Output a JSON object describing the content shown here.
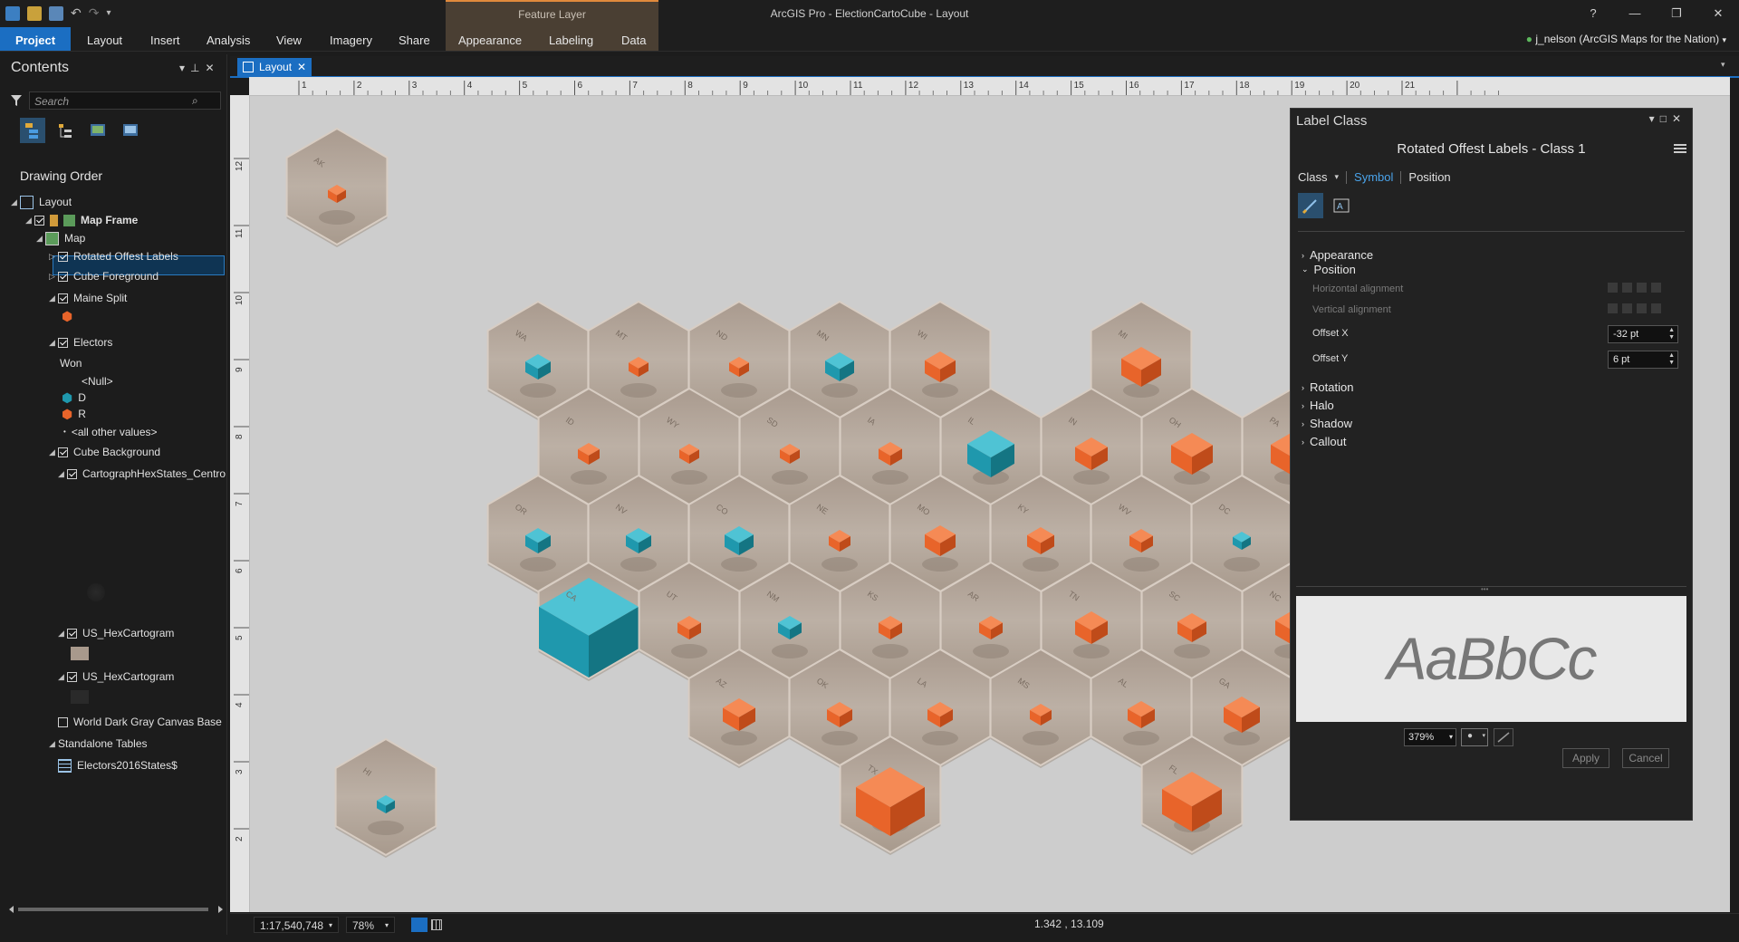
{
  "app": {
    "title": "ArcGIS Pro - ElectionCartoCube - Layout",
    "context_tab_group": "Feature Layer",
    "window_buttons": [
      "?",
      "—",
      "❐",
      "✕"
    ],
    "user": "j_nelson (ArcGIS Maps for the Nation)"
  },
  "ribbon": {
    "tabs": [
      "Project",
      "Layout",
      "Insert",
      "Analysis",
      "View",
      "Imagery",
      "Share",
      "Appearance",
      "Labeling",
      "Data"
    ]
  },
  "contents": {
    "title": "Contents",
    "search_placeholder": "Search",
    "drawing_order_label": "Drawing Order",
    "tree": {
      "layout": "Layout",
      "map_frame": "Map Frame",
      "map": "Map",
      "rotated_offset_labels": "Rotated Offest Labels",
      "cube_foreground": "Cube Foreground",
      "maine_split": "Maine Split",
      "electors": "Electors",
      "won_field": "Won",
      "null_value": "<Null>",
      "d_value": "D",
      "r_value": "R",
      "all_other": "<all other values>",
      "cube_background": "Cube Background",
      "cartograph_centroids": "CartographHexStates_Centro",
      "hex_cartogram_1": "US_HexCartogram",
      "hex_cartogram_2": "US_HexCartogram",
      "basemap": "World Dark Gray Canvas Base",
      "standalone_tables": "Standalone Tables",
      "electors_table": "Electors2016States$"
    }
  },
  "layout_view": {
    "tab_label": "Layout",
    "ruler_top": [
      "1",
      "2",
      "3",
      "4",
      "5",
      "6",
      "7",
      "8",
      "9",
      "10",
      "11",
      "12",
      "13",
      "14",
      "15",
      "16",
      "17",
      "18",
      "19",
      "20",
      "21"
    ],
    "ruler_left": [
      "12",
      "11",
      "10",
      "9",
      "8",
      "7",
      "6",
      "5",
      "4",
      "3",
      "2"
    ],
    "hex_labels": [
      "AK",
      "HI",
      "WA",
      "MT",
      "ND",
      "MN",
      "WI",
      "MI",
      "ID",
      "WY",
      "SD",
      "IA",
      "IL",
      "IN",
      "OH",
      "PA",
      "OR",
      "NV",
      "CO",
      "NE",
      "MO",
      "KY",
      "WV",
      "DC",
      "CA",
      "UT",
      "NM",
      "KS",
      "AR",
      "TN",
      "SC",
      "NC",
      "AZ",
      "OK",
      "LA",
      "MS",
      "AL",
      "GA",
      "TX",
      "FL"
    ]
  },
  "statusbar": {
    "scale": "1:17,540,748",
    "zoom": "78%",
    "coords": "1.342 , 13.109"
  },
  "label_pane": {
    "title": "Label Class",
    "class_name": "Rotated Offest Labels - Class 1",
    "subtabs": {
      "class": "Class",
      "symbol": "Symbol",
      "position": "Position"
    },
    "sections": {
      "appearance": "Appearance",
      "position": "Position",
      "rotation": "Rotation",
      "halo": "Halo",
      "shadow": "Shadow",
      "callout": "Callout"
    },
    "props": {
      "horizontal_alignment": "Horizontal alignment",
      "vertical_alignment": "Vertical alignment",
      "offset_x_label": "Offset X",
      "offset_x_value": "-32 pt",
      "offset_y_label": "Offset Y",
      "offset_y_value": "6 pt"
    },
    "preview_text": "AaBbCc",
    "preview_zoom": "379%",
    "apply": "Apply",
    "cancel": "Cancel"
  },
  "colors": {
    "accent_blue": "#1b6ec2",
    "democrat": "#1f98ad",
    "republican": "#e8642a",
    "hex_fill": "#b5a598",
    "canvas": "#cdcdcd"
  }
}
